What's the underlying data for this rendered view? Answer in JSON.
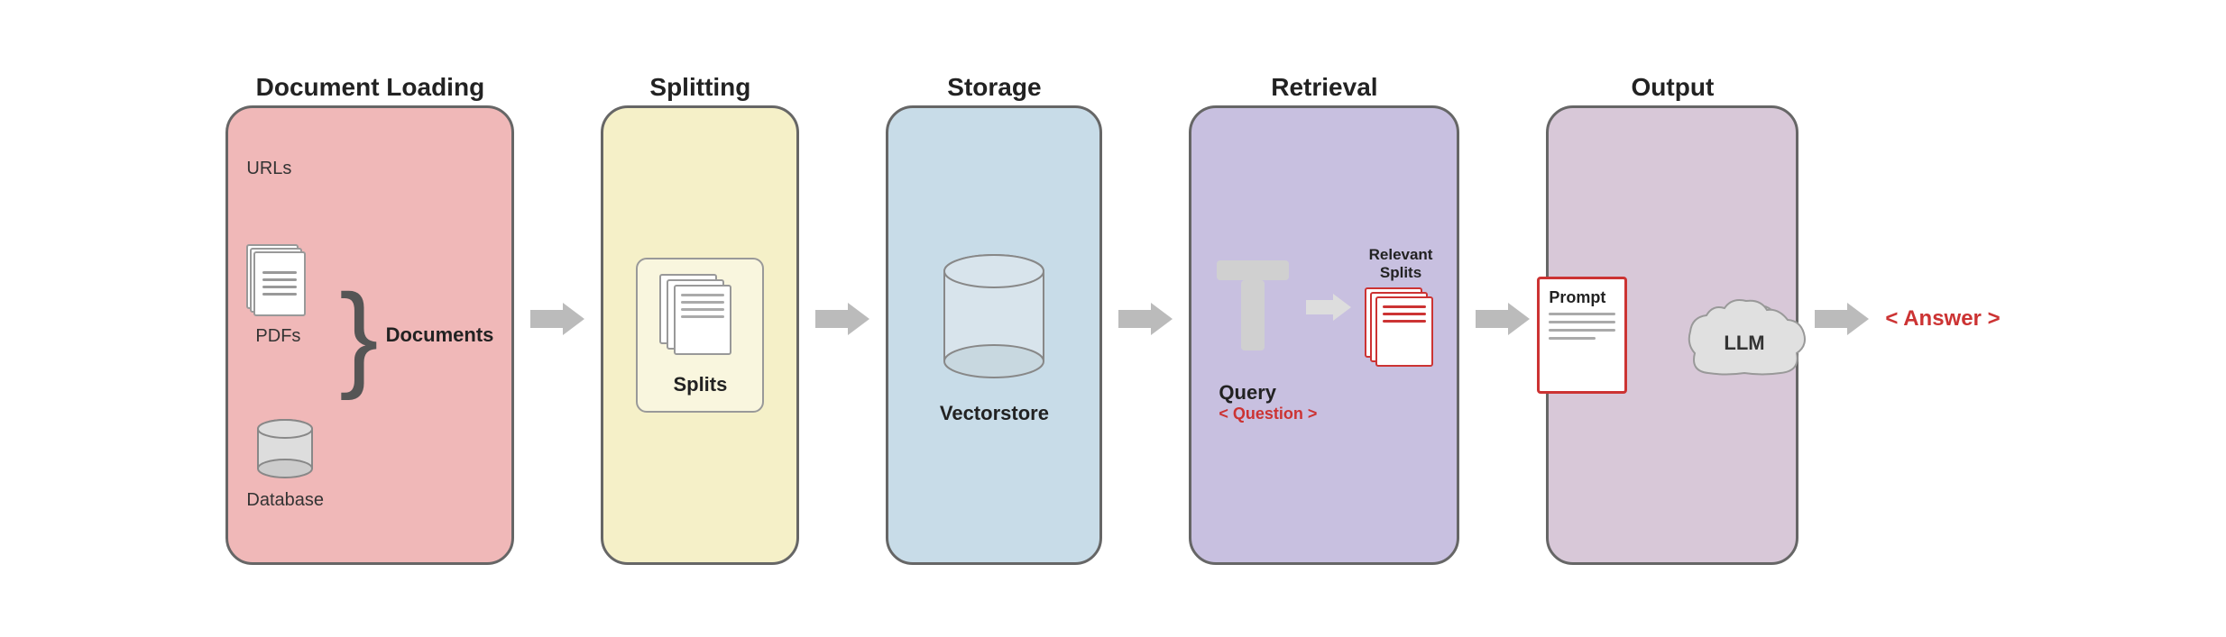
{
  "stages": {
    "doc_loading": {
      "title": "Document Loading",
      "sources": [
        "URLs",
        "PDFs",
        "Database"
      ],
      "label": "Documents"
    },
    "splitting": {
      "title": "Splitting",
      "label": "Splits"
    },
    "storage": {
      "title": "Storage",
      "label": "Vectorstore"
    },
    "retrieval": {
      "title": "Retrieval",
      "relevant_label": "Relevant\nSplits",
      "query_label": "Query",
      "question_label": "< Question >"
    },
    "output": {
      "title": "Output",
      "prompt_label": "Prompt",
      "llm_label": "LLM",
      "answer_label": "< Answer >"
    }
  }
}
